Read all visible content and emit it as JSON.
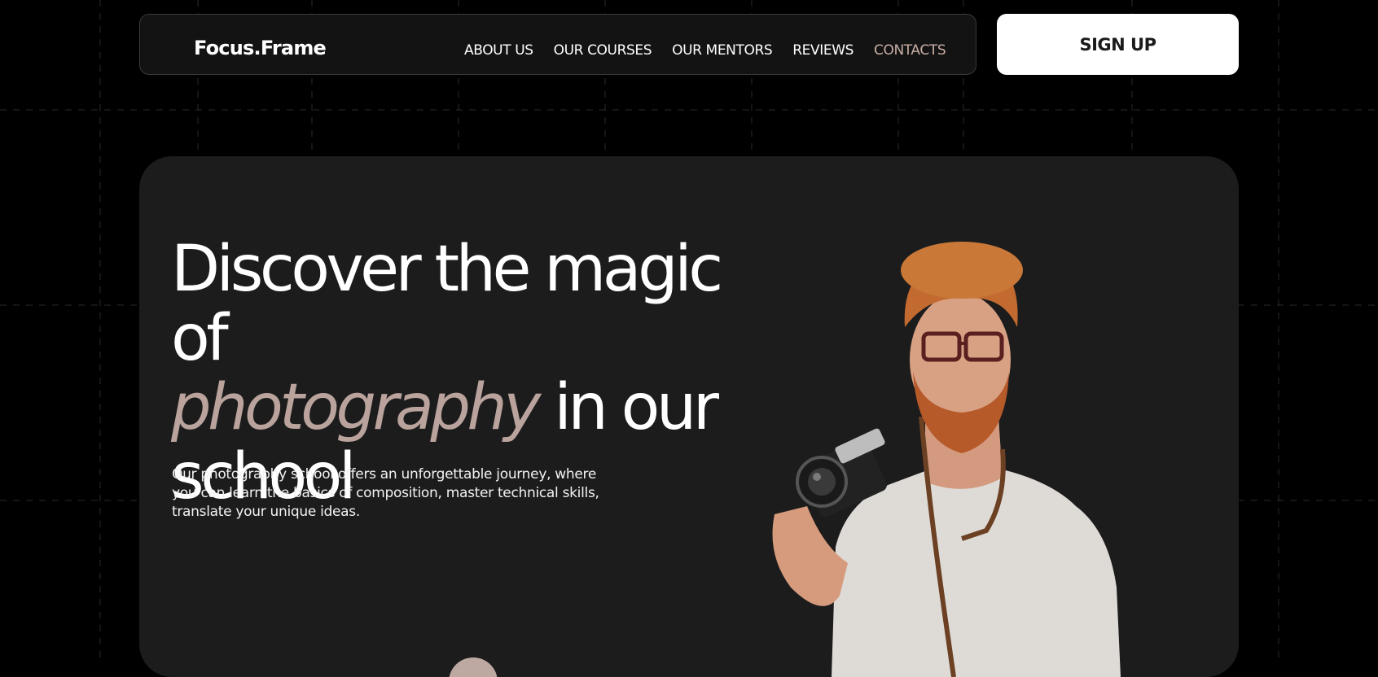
{
  "navbar": {
    "logo": "Focus.Frame",
    "links": [
      "ABOUT US",
      "OUR COURSES",
      "OUR MENTORS",
      "REVIEWS",
      "CONTACTS"
    ]
  },
  "signup_label": "SIGN UP",
  "hero": {
    "headline_part1": "Discover the magic of",
    "headline_em": "photography",
    "headline_part2": " in our",
    "headline_part3": "school",
    "description": "Our photography school offers an unforgettable journey, where you can learn the basics of composition, master technical skills, translate your unique ideas.",
    "image_icon": "photographer-portrait"
  },
  "colors": {
    "background": "#000000",
    "card": "#1c1c1c",
    "accent": "#c8aea4",
    "headline_accent": "#b9a39c",
    "button_bg": "#ffffff"
  }
}
